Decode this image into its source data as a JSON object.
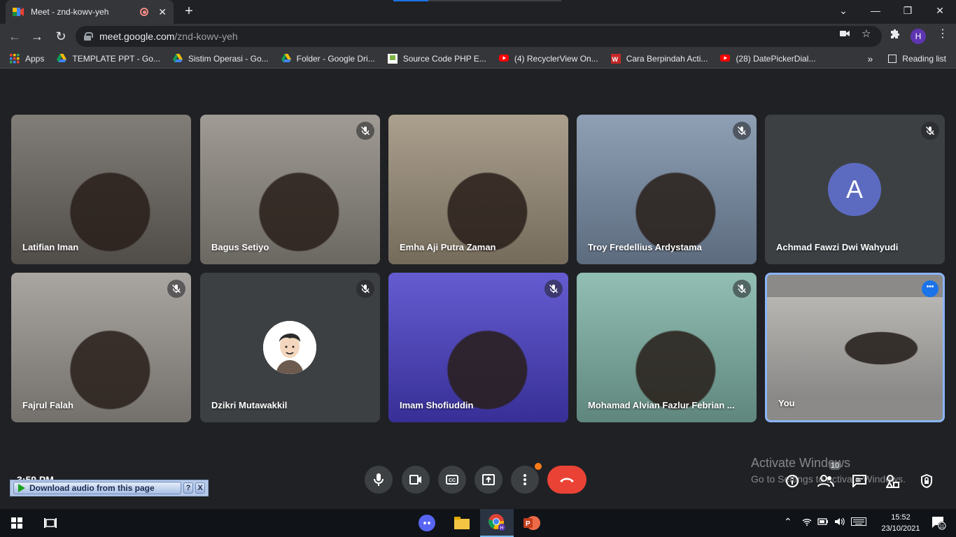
{
  "browser": {
    "tab_title": "Meet - znd-kowv-yeh",
    "url_host": "meet.google.com",
    "url_path": "/znd-kowv-yeh",
    "profile_initial": "H"
  },
  "bookmarks": [
    {
      "label": "Apps",
      "icon": "apps-grid-icon",
      "color": "#ea4335"
    },
    {
      "label": "TEMPLATE PPT - Go...",
      "icon": "google-drive-icon",
      "color": "#fbbc04"
    },
    {
      "label": "Sistim Operasi - Go...",
      "icon": "google-drive-icon",
      "color": "#fbbc04"
    },
    {
      "label": "Folder - Google Dri...",
      "icon": "google-drive-icon",
      "color": "#fbbc04"
    },
    {
      "label": "Source Code PHP E...",
      "icon": "site-icon",
      "color": "#7cb342"
    },
    {
      "label": "(4) RecyclerView On...",
      "icon": "youtube-icon",
      "color": "#ff0000"
    },
    {
      "label": "Cara Berpindah Acti...",
      "icon": "site-red-icon",
      "color": "#c62828"
    },
    {
      "label": "(28) DatePickerDial...",
      "icon": "youtube-icon",
      "color": "#ff0000"
    }
  ],
  "reading_list": "Reading list",
  "participants": [
    {
      "name": "Latifian Iman",
      "muted": false,
      "kind": "video",
      "bg": "#6b6660"
    },
    {
      "name": "Bagus Setiyo",
      "muted": true,
      "kind": "video",
      "bg": "#8f8a82"
    },
    {
      "name": "Emha Aji Putra Zaman",
      "muted": false,
      "kind": "video",
      "bg": "#9c8f7a"
    },
    {
      "name": "Troy Fredellius Ardystama",
      "muted": true,
      "kind": "video",
      "bg": "#7b8fa8"
    },
    {
      "name": "Achmad Fawzi Dwi Wahyudi",
      "muted": true,
      "kind": "avatar",
      "initial": "A",
      "bg": "#3c4043"
    },
    {
      "name": "Fajrul Falah",
      "muted": true,
      "kind": "video",
      "bg": "#9a9590"
    },
    {
      "name": "Dzikri Mutawakkil",
      "muted": true,
      "kind": "cartoon",
      "bg": "#3c4043"
    },
    {
      "name": "Imam Shofiuddin",
      "muted": true,
      "kind": "video",
      "bg": "#4a3fc9"
    },
    {
      "name": "Mohamad Alvian Fazlur Febrian ...",
      "muted": true,
      "kind": "video",
      "bg": "#7fb3a6"
    },
    {
      "name": "You",
      "muted": false,
      "kind": "self",
      "bg": "#8c8a88"
    }
  ],
  "controls": {
    "participants_count": "10",
    "time_text": "3:59 PM"
  },
  "activation": {
    "line1": "Activate Windows",
    "line2": "Go to Settings to activate Windows."
  },
  "download_bar": {
    "label": "Download audio from this page",
    "help": "?",
    "close": "X"
  },
  "taskbar": {
    "time": "15:52",
    "date": "23/10/2021",
    "notif_count": "11"
  }
}
